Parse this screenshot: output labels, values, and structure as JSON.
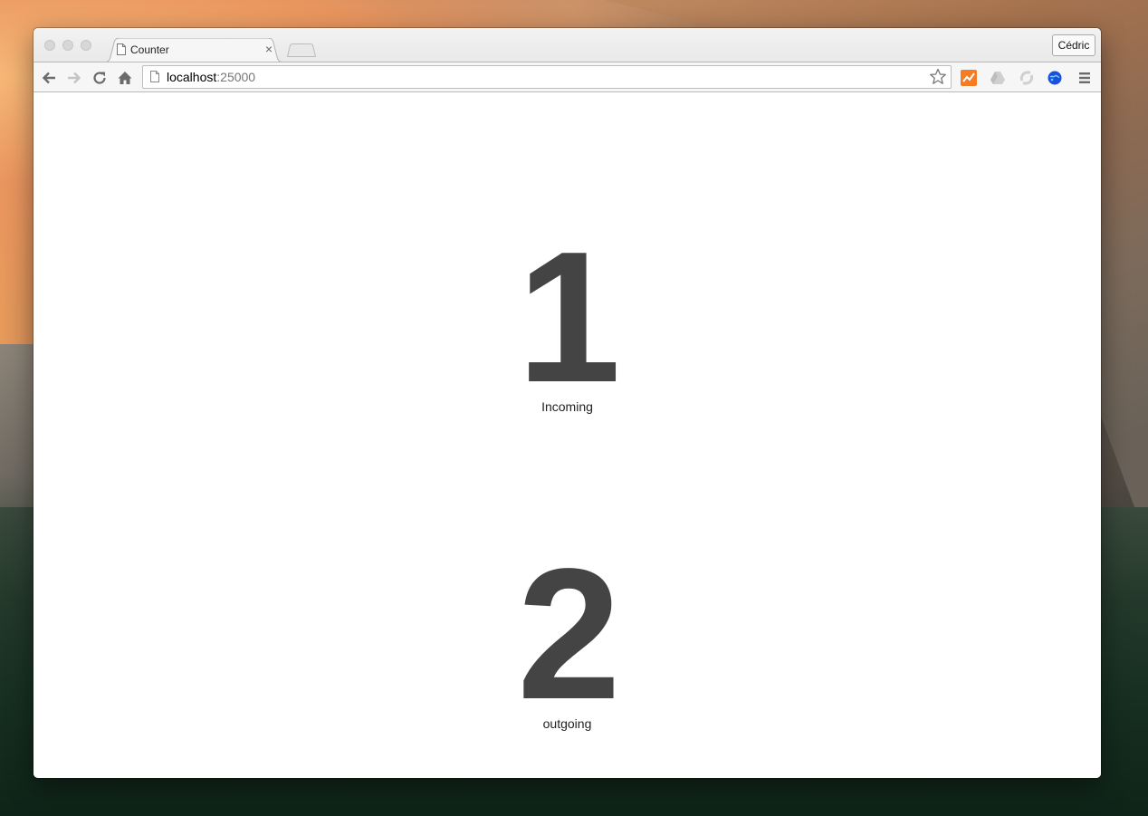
{
  "browser": {
    "tab_title": "Counter",
    "tab_close": "×",
    "profile_name": "Cédric",
    "url_host": "localhost",
    "url_port": ":25000",
    "icons": {
      "back": "arrow-left",
      "forward": "arrow-right",
      "reload": "reload",
      "home": "home",
      "page": "page",
      "star": "star",
      "menu": "hamburger"
    },
    "extensions": [
      "analytics-extension",
      "drive-extension",
      "sync-extension",
      "globe-extension"
    ],
    "colors": {
      "analytics": "#f57c22",
      "globe": "#1a4fe0"
    }
  },
  "counters": [
    {
      "value": "1",
      "label": "Incoming"
    },
    {
      "value": "2",
      "label": "outgoing"
    }
  ],
  "colors": {
    "counter_text": "#444444"
  }
}
